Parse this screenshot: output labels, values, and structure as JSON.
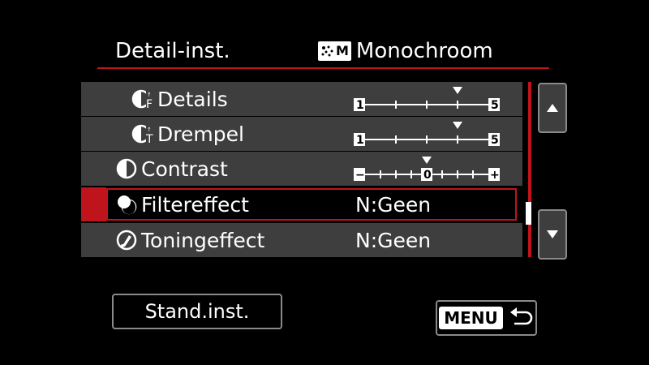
{
  "header": {
    "title": "Detail-inst.",
    "style_badge": "M",
    "style_name": "Monochroom"
  },
  "rows": [
    {
      "label": "Details",
      "type": "slider",
      "min_label": "1",
      "max_label": "5",
      "value": 4
    },
    {
      "label": "Drempel",
      "type": "slider",
      "min_label": "1",
      "max_label": "5",
      "value": 4
    },
    {
      "label": "Contrast",
      "type": "slider",
      "min_label": "−",
      "max_label": "+",
      "center_label": "0",
      "value": 0
    },
    {
      "label": "Filtereffect",
      "type": "value",
      "value": "N:Geen",
      "selected": true
    },
    {
      "label": "Toningeffect",
      "type": "value",
      "value": "N:Geen"
    }
  ],
  "buttons": {
    "default_label": "Stand.inst.",
    "menu_label": "MENU"
  },
  "icons": {
    "scroll_up": "triangle-up-icon",
    "scroll_down": "triangle-down-icon",
    "back": "return-arrow-icon"
  },
  "colors": {
    "accent": "#c0141c",
    "row_bg": "#3e3e3e",
    "bg": "#000000"
  }
}
